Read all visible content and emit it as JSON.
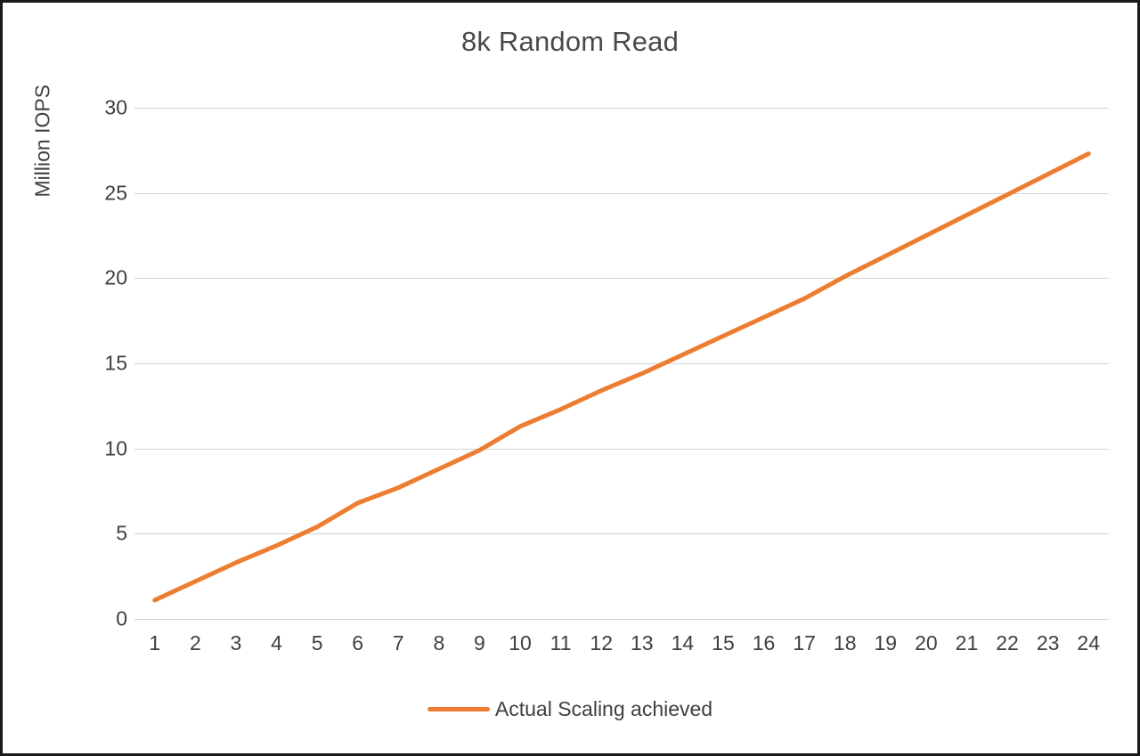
{
  "chart_data": {
    "type": "line",
    "title": "8k Random Read",
    "xlabel": "",
    "ylabel": "Million IOPS",
    "categories": [
      1,
      2,
      3,
      4,
      5,
      6,
      7,
      8,
      9,
      10,
      11,
      12,
      13,
      14,
      15,
      16,
      17,
      18,
      19,
      20,
      21,
      22,
      23,
      24
    ],
    "series": [
      {
        "name": "Actual Scaling achieved",
        "color": "#ED7D31",
        "values": [
          1.1,
          2.2,
          3.3,
          4.3,
          5.4,
          6.8,
          7.7,
          8.8,
          9.9,
          11.3,
          12.3,
          13.4,
          14.4,
          15.5,
          16.6,
          17.7,
          18.8,
          20.1,
          21.3,
          22.5,
          23.7,
          24.9,
          26.1,
          27.3
        ]
      }
    ],
    "ylim": [
      0,
      30
    ],
    "ytick_values": [
      0,
      5,
      10,
      15,
      20,
      25,
      30
    ],
    "xtick_labels": [
      "1",
      "2",
      "3",
      "4",
      "5",
      "6",
      "7",
      "8",
      "9",
      "10",
      "11",
      "12",
      "13",
      "14",
      "15",
      "16",
      "17",
      "18",
      "19",
      "20",
      "21",
      "22",
      "23",
      "24"
    ],
    "ytick_labels": [
      "0",
      "5",
      "10",
      "15",
      "20",
      "25",
      "30"
    ],
    "grid": "horizontal",
    "legend_position": "bottom",
    "legend_entries": [
      "Actual Scaling achieved"
    ]
  }
}
